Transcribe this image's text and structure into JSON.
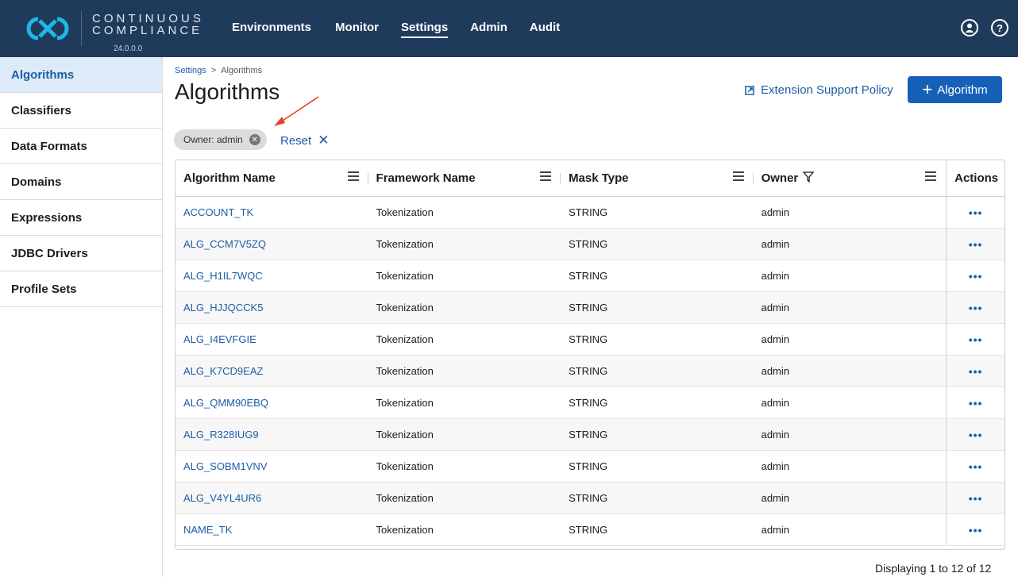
{
  "header": {
    "logo_line1": "CONTINUOUS",
    "logo_line2": "COMPLIANCE",
    "version": "24.0.0.0",
    "nav": [
      {
        "label": "Environments",
        "active": false
      },
      {
        "label": "Monitor",
        "active": false
      },
      {
        "label": "Settings",
        "active": true
      },
      {
        "label": "Admin",
        "active": false
      },
      {
        "label": "Audit",
        "active": false
      }
    ],
    "user_icon": "user-circle-icon",
    "help_icon": "help-circle-icon",
    "help_glyph": "?"
  },
  "sidebar": {
    "items": [
      {
        "label": "Algorithms",
        "active": true
      },
      {
        "label": "Classifiers",
        "active": false
      },
      {
        "label": "Data Formats",
        "active": false
      },
      {
        "label": "Domains",
        "active": false
      },
      {
        "label": "Expressions",
        "active": false
      },
      {
        "label": "JDBC Drivers",
        "active": false
      },
      {
        "label": "Profile Sets",
        "active": false
      }
    ]
  },
  "main": {
    "breadcrumb": {
      "parent": "Settings",
      "separator": ">",
      "current": "Algorithms"
    },
    "title": "Algorithms",
    "extension_link": "Extension Support Policy",
    "add_button": "Algorithm",
    "add_button_glyph": "+",
    "filter_chip": "Owner: admin",
    "reset_label": "Reset",
    "reset_glyph": "✕",
    "table": {
      "columns": [
        "Algorithm Name",
        "Framework Name",
        "Mask Type",
        "Owner",
        "Actions"
      ],
      "rows": [
        {
          "name": "ACCOUNT_TK",
          "framework": "Tokenization",
          "mask_type": "STRING",
          "owner": "admin"
        },
        {
          "name": "ALG_CCM7V5ZQ",
          "framework": "Tokenization",
          "mask_type": "STRING",
          "owner": "admin"
        },
        {
          "name": "ALG_H1IL7WQC",
          "framework": "Tokenization",
          "mask_type": "STRING",
          "owner": "admin"
        },
        {
          "name": "ALG_HJJQCCK5",
          "framework": "Tokenization",
          "mask_type": "STRING",
          "owner": "admin"
        },
        {
          "name": "ALG_I4EVFGIE",
          "framework": "Tokenization",
          "mask_type": "STRING",
          "owner": "admin"
        },
        {
          "name": "ALG_K7CD9EAZ",
          "framework": "Tokenization",
          "mask_type": "STRING",
          "owner": "admin"
        },
        {
          "name": "ALG_QMM90EBQ",
          "framework": "Tokenization",
          "mask_type": "STRING",
          "owner": "admin"
        },
        {
          "name": "ALG_R328IUG9",
          "framework": "Tokenization",
          "mask_type": "STRING",
          "owner": "admin"
        },
        {
          "name": "ALG_SOBM1VNV",
          "framework": "Tokenization",
          "mask_type": "STRING",
          "owner": "admin"
        },
        {
          "name": "ALG_V4YL4UR6",
          "framework": "Tokenization",
          "mask_type": "STRING",
          "owner": "admin"
        },
        {
          "name": "NAME_TK",
          "framework": "Tokenization",
          "mask_type": "STRING",
          "owner": "admin"
        }
      ],
      "actions_glyph": "•••"
    },
    "footer": "Displaying 1 to 12 of 12"
  },
  "colors": {
    "topbar": "#1f3b5c",
    "accent": "#1660b8",
    "link": "#1b5ea6",
    "annotation_arrow": "#e8402a"
  }
}
